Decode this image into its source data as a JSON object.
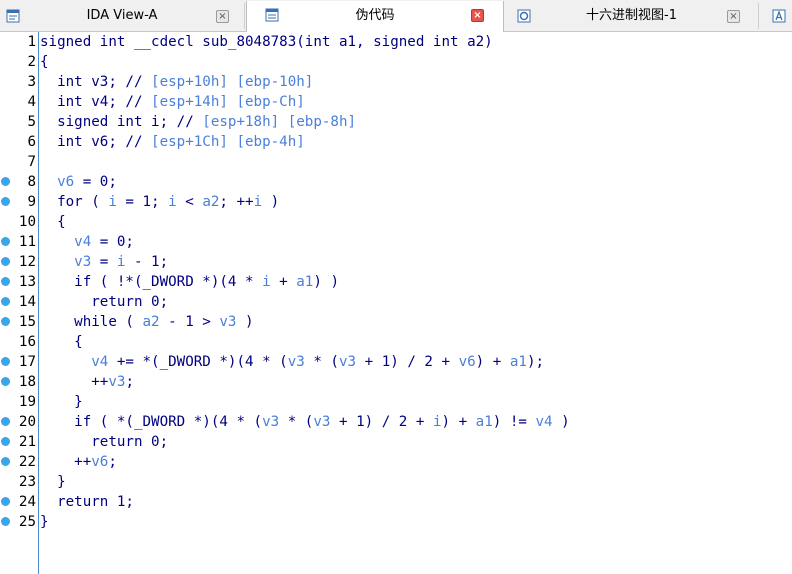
{
  "tabs": [
    {
      "label": "IDA View-A",
      "icon": "ida-view-icon",
      "active": false
    },
    {
      "label": "伪代码",
      "icon": "pseudocode-icon",
      "active": true
    },
    {
      "label": "十六进制视图-1",
      "icon": "hex-view-icon",
      "active": false
    },
    {
      "label": "",
      "icon": "structures-icon",
      "active": false
    }
  ],
  "close_glyph": "×",
  "code": {
    "lines": [
      {
        "n": "1",
        "bp": false,
        "segs": [
          [
            "signed int __cdecl sub_8048783(int a1, signed int a2)",
            "k"
          ]
        ]
      },
      {
        "n": "2",
        "bp": false,
        "segs": [
          [
            "{",
            "k"
          ]
        ]
      },
      {
        "n": "3",
        "bp": false,
        "segs": [
          [
            "  int v3; // ",
            "k"
          ],
          [
            "[esp+10h] [ebp-10h]",
            "c"
          ]
        ]
      },
      {
        "n": "4",
        "bp": false,
        "segs": [
          [
            "  int v4; // ",
            "k"
          ],
          [
            "[esp+14h] [ebp-Ch]",
            "c"
          ]
        ]
      },
      {
        "n": "5",
        "bp": false,
        "segs": [
          [
            "  signed int i; // ",
            "k"
          ],
          [
            "[esp+18h] [ebp-8h]",
            "c"
          ]
        ]
      },
      {
        "n": "6",
        "bp": false,
        "segs": [
          [
            "  int v6; // ",
            "k"
          ],
          [
            "[esp+1Ch] [ebp-4h]",
            "c"
          ]
        ]
      },
      {
        "n": "7",
        "bp": false,
        "segs": [
          [
            "",
            "k"
          ]
        ]
      },
      {
        "n": "8",
        "bp": true,
        "segs": [
          [
            "  ",
            "k"
          ],
          [
            "v6",
            "v"
          ],
          [
            " = 0;",
            "k"
          ]
        ]
      },
      {
        "n": "9",
        "bp": true,
        "segs": [
          [
            "  for ( ",
            "k"
          ],
          [
            "i",
            "v"
          ],
          [
            " = 1; ",
            "k"
          ],
          [
            "i",
            "v"
          ],
          [
            " < ",
            "k"
          ],
          [
            "a2",
            "v"
          ],
          [
            "; ++",
            "k"
          ],
          [
            "i",
            "v"
          ],
          [
            " )",
            "k"
          ]
        ]
      },
      {
        "n": "10",
        "bp": false,
        "segs": [
          [
            "  {",
            "k"
          ]
        ]
      },
      {
        "n": "11",
        "bp": true,
        "segs": [
          [
            "    ",
            "k"
          ],
          [
            "v4",
            "v"
          ],
          [
            " = 0;",
            "k"
          ]
        ]
      },
      {
        "n": "12",
        "bp": true,
        "segs": [
          [
            "    ",
            "k"
          ],
          [
            "v3",
            "v"
          ],
          [
            " = ",
            "k"
          ],
          [
            "i",
            "v"
          ],
          [
            " - 1;",
            "k"
          ]
        ]
      },
      {
        "n": "13",
        "bp": true,
        "segs": [
          [
            "    if ( !*(_DWORD *)(4 * ",
            "k"
          ],
          [
            "i",
            "v"
          ],
          [
            " + ",
            "k"
          ],
          [
            "a1",
            "v"
          ],
          [
            ") )",
            "k"
          ]
        ]
      },
      {
        "n": "14",
        "bp": true,
        "segs": [
          [
            "      return 0;",
            "k"
          ]
        ]
      },
      {
        "n": "15",
        "bp": true,
        "segs": [
          [
            "    while ( ",
            "k"
          ],
          [
            "a2",
            "v"
          ],
          [
            " - 1 > ",
            "k"
          ],
          [
            "v3",
            "v"
          ],
          [
            " )",
            "k"
          ]
        ]
      },
      {
        "n": "16",
        "bp": false,
        "segs": [
          [
            "    {",
            "k"
          ]
        ]
      },
      {
        "n": "17",
        "bp": true,
        "segs": [
          [
            "      ",
            "k"
          ],
          [
            "v4",
            "v"
          ],
          [
            " += *(_DWORD *)(4 * (",
            "k"
          ],
          [
            "v3",
            "v"
          ],
          [
            " * (",
            "k"
          ],
          [
            "v3",
            "v"
          ],
          [
            " + 1) / 2 + ",
            "k"
          ],
          [
            "v6",
            "v"
          ],
          [
            ") + ",
            "k"
          ],
          [
            "a1",
            "v"
          ],
          [
            ");",
            "k"
          ]
        ]
      },
      {
        "n": "18",
        "bp": true,
        "segs": [
          [
            "      ++",
            "k"
          ],
          [
            "v3",
            "v"
          ],
          [
            ";",
            "k"
          ]
        ]
      },
      {
        "n": "19",
        "bp": false,
        "segs": [
          [
            "    }",
            "k"
          ]
        ]
      },
      {
        "n": "20",
        "bp": true,
        "segs": [
          [
            "    if ( *(_DWORD *)(4 * (",
            "k"
          ],
          [
            "v3",
            "v"
          ],
          [
            " * (",
            "k"
          ],
          [
            "v3",
            "v"
          ],
          [
            " + 1) / 2 + ",
            "k"
          ],
          [
            "i",
            "v"
          ],
          [
            ") + ",
            "k"
          ],
          [
            "a1",
            "v"
          ],
          [
            ") != ",
            "k"
          ],
          [
            "v4",
            "v"
          ],
          [
            " )",
            "k"
          ]
        ]
      },
      {
        "n": "21",
        "bp": true,
        "segs": [
          [
            "      return 0;",
            "k"
          ]
        ]
      },
      {
        "n": "22",
        "bp": true,
        "segs": [
          [
            "    ++",
            "k"
          ],
          [
            "v6",
            "v"
          ],
          [
            ";",
            "k"
          ]
        ]
      },
      {
        "n": "23",
        "bp": false,
        "segs": [
          [
            "  }",
            "k"
          ]
        ]
      },
      {
        "n": "24",
        "bp": true,
        "segs": [
          [
            "  return 1;",
            "k"
          ]
        ]
      },
      {
        "n": "25",
        "bp": true,
        "segs": [
          [
            "}",
            "k"
          ]
        ]
      }
    ]
  },
  "colors": {
    "keyword": "#000080",
    "variable": "#4a7fd9",
    "breakpoint": "#3aa6e8",
    "active_close": "#e8534a"
  }
}
